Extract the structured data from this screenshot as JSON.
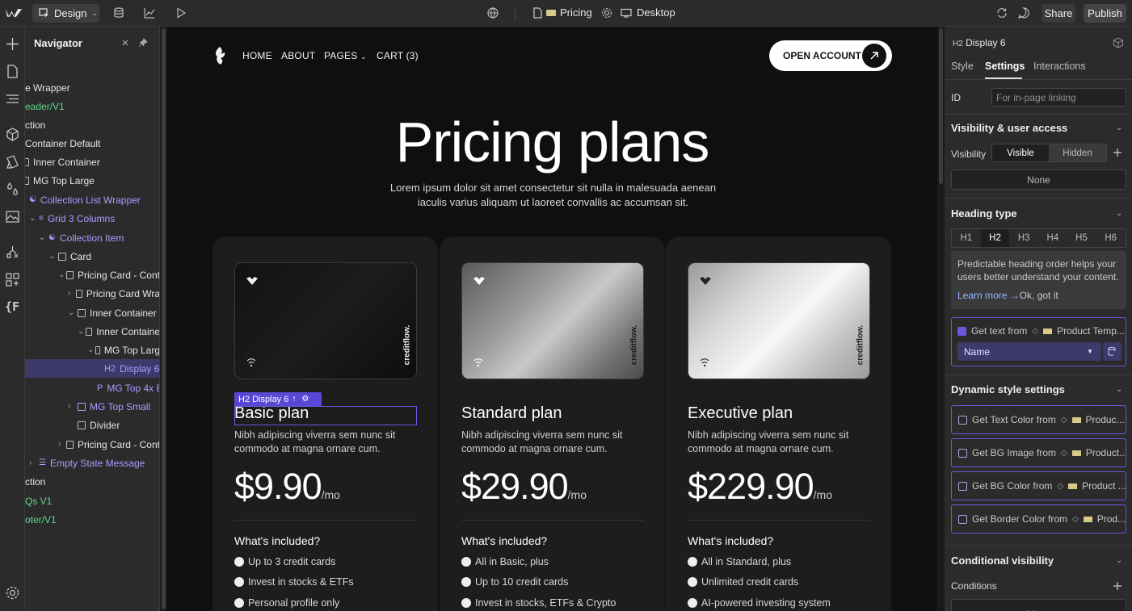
{
  "topbar": {
    "mode_label": "Design",
    "page_name": "Pricing",
    "device": "Desktop",
    "share": "Share",
    "publish": "Publish"
  },
  "navigator": {
    "title": "Navigator",
    "items": [
      {
        "label": "e Wrapper",
        "color": "white"
      },
      {
        "label": "eader/V1",
        "color": "green"
      },
      {
        "label": "ction",
        "color": "white"
      },
      {
        "label": "Container Default",
        "color": "white"
      },
      {
        "label": "Inner Container",
        "color": "white"
      },
      {
        "label": "MG Top Large",
        "color": "white"
      },
      {
        "label": "Collection List Wrapper",
        "color": "purple"
      },
      {
        "label": "Grid 3 Columns",
        "color": "purple"
      },
      {
        "label": "Collection Item",
        "color": "purple"
      },
      {
        "label": "Card",
        "color": "white"
      },
      {
        "label": "Pricing Card - Cont",
        "color": "white"
      },
      {
        "label": "Pricing Card Wra",
        "color": "white"
      },
      {
        "label": "Inner Container",
        "color": "white"
      },
      {
        "label": "Inner Containe",
        "color": "white"
      },
      {
        "label": "MG Top Larg",
        "color": "white"
      },
      {
        "label": "Display 6",
        "tag": "H2",
        "color": "purple",
        "selected": true
      },
      {
        "label": "MG Top 4x E",
        "tag": "P",
        "color": "purple"
      },
      {
        "label": "MG Top Small",
        "color": "purple"
      },
      {
        "label": "Divider",
        "color": "white"
      },
      {
        "label": "Pricing Card - Cont",
        "color": "white"
      },
      {
        "label": "Empty State Message",
        "color": "purple"
      },
      {
        "label": "ction",
        "color": "white"
      },
      {
        "label": "Qs V1",
        "color": "green"
      },
      {
        "label": "oter/V1",
        "color": "green"
      }
    ]
  },
  "site": {
    "menu": [
      "HOME",
      "ABOUT",
      "PAGES",
      "CART (3)"
    ],
    "cta": "OPEN ACCOUNT",
    "heading": "Pricing plans",
    "subheading_line1": "Lorem ipsum dolor sit amet consectetur sit nulla in malesuada aenean",
    "subheading_line2": "iaculis varius aliquam ut laoreet convallis ac accumsan sit.",
    "selection_tag": "H2  Display 6",
    "card_brand": "creditflow.",
    "plans": [
      {
        "name": "Basic plan",
        "desc_line1": "Nibh adipiscing viverra sem nunc sit",
        "desc_line2": "commodo at magna ornare cum.",
        "price": "$9.90",
        "per": "/mo",
        "included": "What's included?",
        "features": [
          "Up to 3 credit cards",
          "Invest in stocks & ETFs",
          "Personal profile only"
        ]
      },
      {
        "name": "Standard plan",
        "desc_line1": "Nibh adipiscing viverra sem nunc sit",
        "desc_line2": "commodo at magna ornare cum.",
        "price": "$29.90",
        "per": "/mo",
        "included": "What's included?",
        "features": [
          "All in Basic, plus",
          "Up to 10 credit cards",
          "Invest in stocks, ETFs & Crypto"
        ]
      },
      {
        "name": "Executive plan",
        "desc_line1": "Nibh adipiscing viverra sem nunc sit",
        "desc_line2": "commodo at magna ornare cum.",
        "price": "$229.90",
        "per": "/mo",
        "included": "What's included?",
        "features": [
          "All in Standard, plus",
          "Unlimited credit cards",
          "AI-powered investing system"
        ]
      }
    ]
  },
  "panel": {
    "element": "Display 6",
    "element_tag": "H2",
    "tabs": [
      "Style",
      "Settings",
      "Interactions"
    ],
    "id_label": "ID",
    "id_placeholder": "For in-page linking",
    "visibility_section": "Visibility & user access",
    "visibility_label": "Visibility",
    "visible": "Visible",
    "hidden": "Hidden",
    "none": "None",
    "heading_type_section": "Heading type",
    "heading_levels": [
      "H1",
      "H2",
      "H3",
      "H4",
      "H5",
      "H6"
    ],
    "heading_selected": "H2",
    "note_line1": "Predictable heading order helps your",
    "note_line2": "users better understand your content.",
    "learn_more": "Learn more →",
    "ok_got_it": "Ok, got it",
    "get_text_from": "Get text from",
    "product_temp": "Product Temp...",
    "name_select": "Name",
    "dynamic_section": "Dynamic style settings",
    "dynamic": [
      {
        "label": "Get Text Color from",
        "source": "Produc..."
      },
      {
        "label": "Get BG Image from",
        "source": "Product..."
      },
      {
        "label": "Get BG Color from",
        "source": "Product ..."
      },
      {
        "label": "Get Border Color from",
        "source": "Prod..."
      }
    ],
    "conditional_section": "Conditional visibility",
    "conditions_label": "Conditions",
    "conditions_value": "None"
  }
}
